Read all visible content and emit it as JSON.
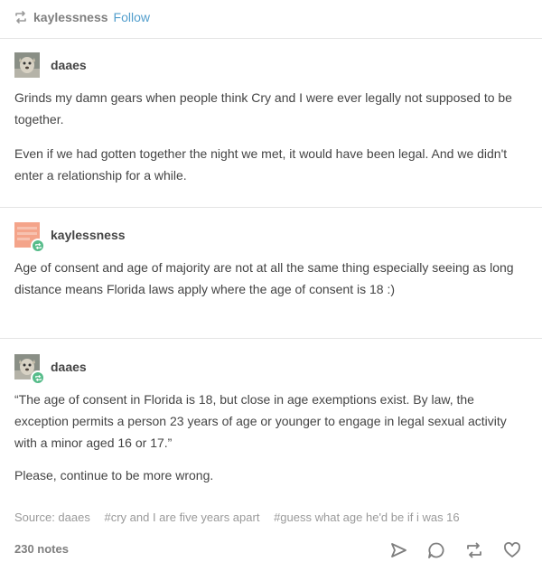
{
  "header": {
    "reblogger": "kaylessness",
    "follow_label": "Follow"
  },
  "posts": [
    {
      "author": "daaes",
      "paragraphs": [
        "Grinds my damn gears when people think Cry and I were ever legally not supposed to be together.",
        "Even if we had gotten together the night we met, it would have been legal. And we didn't enter a relationship for a while."
      ]
    },
    {
      "author": "kaylessness",
      "paragraphs": [
        "Age of consent and age of majority are not at all the same thing especially seeing as long distance means Florida laws apply where the age of consent is 18 :)"
      ]
    },
    {
      "author": "daaes",
      "paragraphs": [
        "“The age of consent in Florida is 18, but close in age exemptions exist. By law, the exception permits a person 23 years of age or younger to engage in legal sexual activity with a minor aged 16 or 17.”",
        "Please, continue to be more wrong."
      ]
    }
  ],
  "source": {
    "label": "Source: daaes"
  },
  "tags": [
    "#cry and I are five years apart",
    "#guess what age he'd be if i was 16"
  ],
  "footer": {
    "notes": "230 notes",
    "icons": [
      "share-icon",
      "reply-icon",
      "reblog-icon",
      "like-icon"
    ]
  }
}
